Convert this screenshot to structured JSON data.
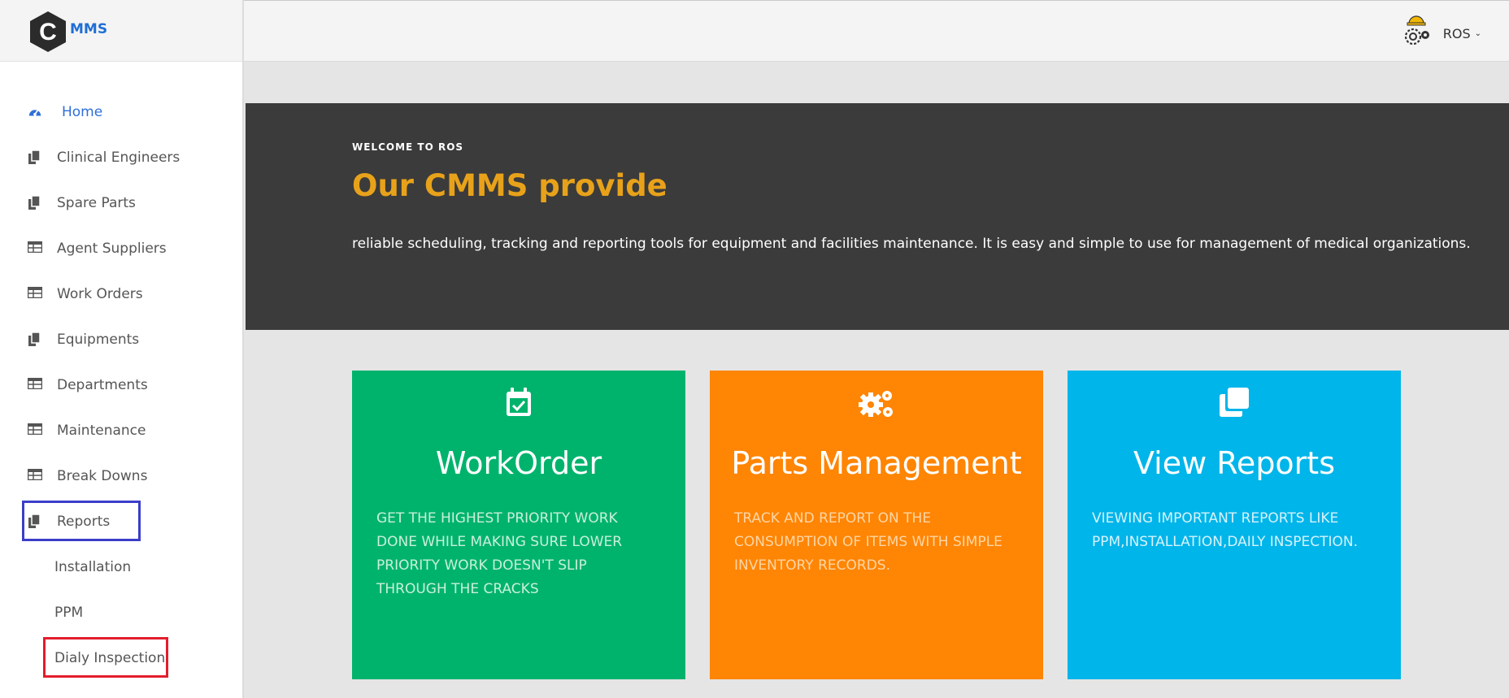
{
  "brand": {
    "logo_letter": "C",
    "logo_text": "MMS"
  },
  "header": {
    "user_name": "ROS"
  },
  "sidebar": {
    "items": [
      {
        "label": "Home",
        "icon": "dashboard-icon",
        "active": true
      },
      {
        "label": "Clinical Engineers",
        "icon": "copy-icon"
      },
      {
        "label": "Spare Parts",
        "icon": "copy-icon"
      },
      {
        "label": "Agent Suppliers",
        "icon": "table-icon"
      },
      {
        "label": "Work Orders",
        "icon": "table-icon"
      },
      {
        "label": "Equipments",
        "icon": "copy-icon"
      },
      {
        "label": "Departments",
        "icon": "table-icon"
      },
      {
        "label": "Maintenance",
        "icon": "table-icon"
      },
      {
        "label": "Break Downs",
        "icon": "table-icon"
      },
      {
        "label": "Reports",
        "icon": "copy-icon"
      }
    ],
    "sub_items": [
      {
        "label": "Installation"
      },
      {
        "label": "PPM"
      },
      {
        "label": "Dialy Inspection"
      }
    ]
  },
  "hero": {
    "kicker": "WELCOME TO ROS",
    "title": "Our CMMS provide",
    "description": "reliable scheduling, tracking and reporting tools for equipment and facilities maintenance. It is easy and simple to use for management of medical organizations."
  },
  "cards": [
    {
      "title": "WorkOrder",
      "icon": "calendar-check-icon",
      "color": "#00b36c",
      "body": "GET THE HIGHEST PRIORITY WORK DONE WHILE MAKING SURE LOWER PRIORITY WORK DOESN'T SLIP THROUGH THE CRACKS"
    },
    {
      "title": "Parts Management",
      "icon": "gears-icon",
      "color": "#ff8504",
      "body": "TRACK AND REPORT ON THE CONSUMPTION OF ITEMS WITH SIMPLE INVENTORY RECORDS."
    },
    {
      "title": "View Reports",
      "icon": "clone-icon",
      "color": "#00b5ea",
      "body": "VIEWING IMPORTANT REPORTS LIKE PPM,INSTALLATION,DAILY INSPECTION."
    }
  ],
  "colors": {
    "accent": "#e8a21a",
    "active_link": "#2f6fd8",
    "hero_bg": "#3b3b3b"
  }
}
